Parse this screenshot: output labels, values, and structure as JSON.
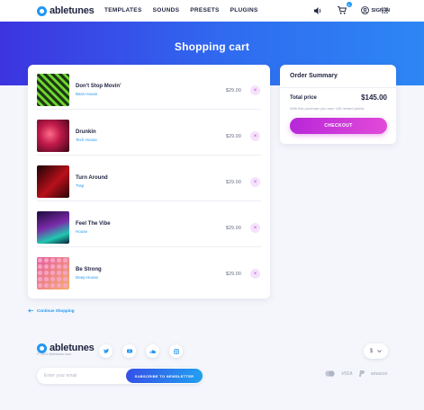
{
  "header": {
    "brand": "abletunes",
    "menu": [
      "TEMPLATES",
      "SOUNDS",
      "PRESETS",
      "PLUGINS"
    ],
    "cart_count": "5",
    "sign_in": "SIGN IN"
  },
  "hero": {
    "title": "Shopping cart"
  },
  "cart": {
    "items": [
      {
        "title": "Don't Stop Movin'",
        "genre": "Bass House",
        "price": "$29.00"
      },
      {
        "title": "Drunkin",
        "genre": "Tech House",
        "price": "$29.00"
      },
      {
        "title": "Turn Around",
        "genre": "Trap",
        "price": "$29.00"
      },
      {
        "title": "Feel The Vibe",
        "genre": "House",
        "price": "$29.00"
      },
      {
        "title": "Be Strong",
        "genre": "Deep House",
        "price": "$29.00"
      }
    ],
    "remove_symbol": "×"
  },
  "summary": {
    "title": "Order Summary",
    "total_label": "Total price",
    "total_value": "$145.00",
    "reward_note": "With this purchase you earn 145 reward points",
    "checkout_label": "CHECKOUT"
  },
  "continue_label": "Continue Shopping",
  "footer": {
    "brand": "abletunes",
    "copyright": "© 2021 Abletunes.com",
    "currency": "$",
    "newsletter_placeholder": "Enter your email",
    "subscribe_label": "SUBSCRIBE TO NEWSLETTER",
    "payments": [
      "VISA",
      "amazon"
    ]
  },
  "colors": {
    "accent": "#2196f3",
    "checkout": "#c43ad9",
    "hero_start": "#3d34e0",
    "hero_end": "#2d86f4"
  }
}
